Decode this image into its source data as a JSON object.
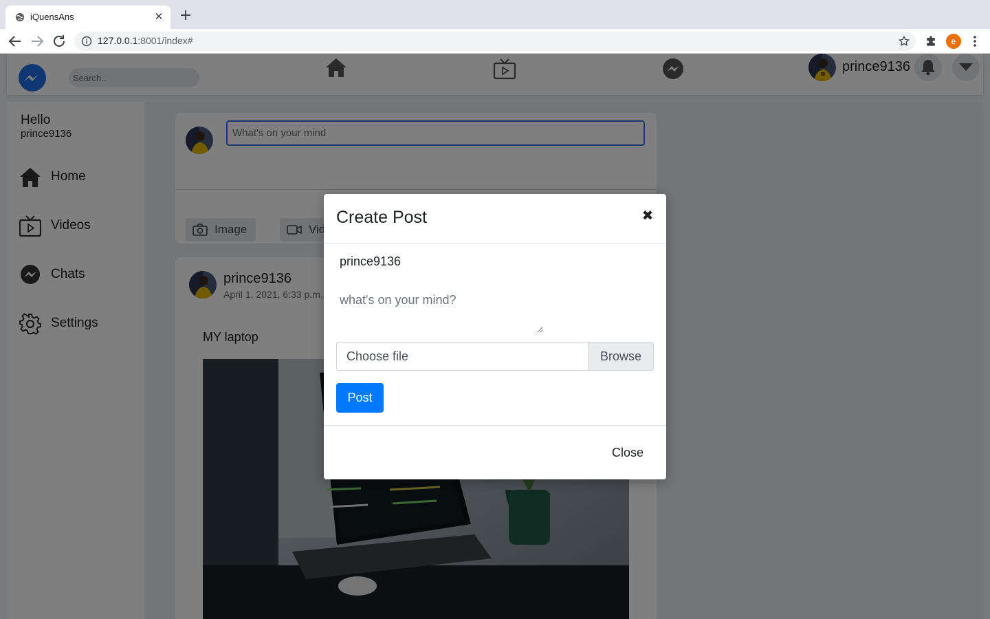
{
  "browser": {
    "tab_title": "iQuensAns",
    "tab_close": "✕",
    "new_tab": "+",
    "url_host": "127.0.0.1",
    "url_path": ":8001/index#",
    "profile_initial": "e"
  },
  "topnav": {
    "search_placeholder": "Search..",
    "username": "prince9136",
    "icons": [
      "messenger-logo-icon",
      "home-icon",
      "tv-icon",
      "messenger-icon",
      "bell-icon",
      "caret-down-icon"
    ]
  },
  "sidebar": {
    "greeting": "Hello",
    "username": "prince9136",
    "items": [
      {
        "label": "Home",
        "icon": "home-icon"
      },
      {
        "label": "Videos",
        "icon": "tv-icon"
      },
      {
        "label": "Chats",
        "icon": "messenger-icon"
      },
      {
        "label": "Settings",
        "icon": "gear-icon"
      }
    ]
  },
  "composer": {
    "placeholder": "What's on your mind",
    "buttons": [
      {
        "label": "Image",
        "icon": "camera-icon"
      },
      {
        "label": "Video",
        "icon": "video-icon"
      }
    ]
  },
  "post": {
    "author": "prince9136",
    "date": "April 1, 2021, 6:33 p.m.",
    "text": "MY laptop"
  },
  "modal": {
    "title": "Create Post",
    "close_x": "✖",
    "username": "prince9136",
    "textarea_placeholder": "what's on your mind?",
    "file_label": "Choose file",
    "browse_label": "Browse",
    "post_label": "Post",
    "close_label": "Close"
  },
  "colors": {
    "primary": "#007bff",
    "brand": "#1f6fe5",
    "overlay": "rgba(0,0,0,0.5)"
  }
}
